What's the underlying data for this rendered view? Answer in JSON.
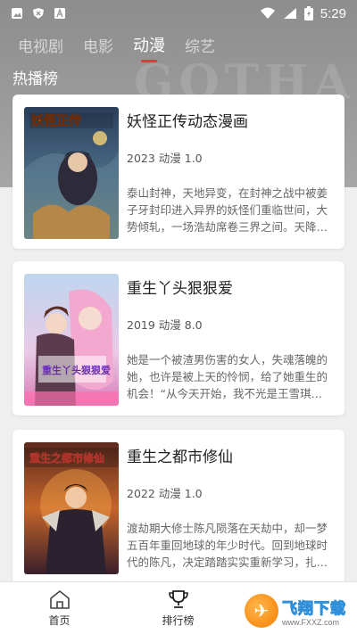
{
  "status_bar": {
    "time": "5:29",
    "left_icons": [
      "gallery-icon",
      "shield-icon",
      "keyboard-a-icon"
    ],
    "right_icons": [
      "wifi-icon",
      "signal-icon",
      "battery-charging-icon"
    ]
  },
  "hero": {
    "watermark": "GOTHAM"
  },
  "tabs": [
    {
      "label": "电视剧",
      "active": false
    },
    {
      "label": "电影",
      "active": false
    },
    {
      "label": "动漫",
      "active": true
    },
    {
      "label": "综艺",
      "active": false
    }
  ],
  "section_title": "热播榜",
  "cards": [
    {
      "title": "妖怪正传动态漫画",
      "meta": "2023 动漫 1.0",
      "desc": "泰山封神，天地异变，在封神之战中被姜子牙封印进入异界的妖怪们重临世间，大势倾轧，一场浩劫席卷三界之间。天降大任于斯人也，道宗弟子江…",
      "cover_caption": "妖怪正传"
    },
    {
      "title": "重生丫头狠狠爱",
      "meta": "2019 动漫 8.0",
      "desc": "她是一个被渣男伤害的女人，失魂落魄的她，也许是被上天的怜悯，给了她重生的机会！“从今天开始，我不光是王雪琪，我也是冷月，我不光为自己而活…",
      "cover_caption": "重生丫头狠狠爱"
    },
    {
      "title": "重生之都市修仙",
      "meta": "2022 动漫 1.0",
      "desc": "渡劫期大修士陈凡陨落在天劫中，却一梦五百年重回地球的年少时代。回到地球时代的陈凡，决定踏踏实实重新学习，扎实根基，同时弥补之前的遗憾…",
      "cover_caption": "重生之都市修仙"
    }
  ],
  "bottom_nav": [
    {
      "label": "首页",
      "icon": "home-icon"
    },
    {
      "label": "排行榜",
      "icon": "trophy-icon"
    }
  ],
  "watermark_brand": {
    "name": "飞翔下载",
    "url": "www.FXXZ.com"
  },
  "colors": {
    "accent": "#e5383b",
    "hero_bg": "#9a9a9a",
    "page_bg": "#efefef"
  }
}
